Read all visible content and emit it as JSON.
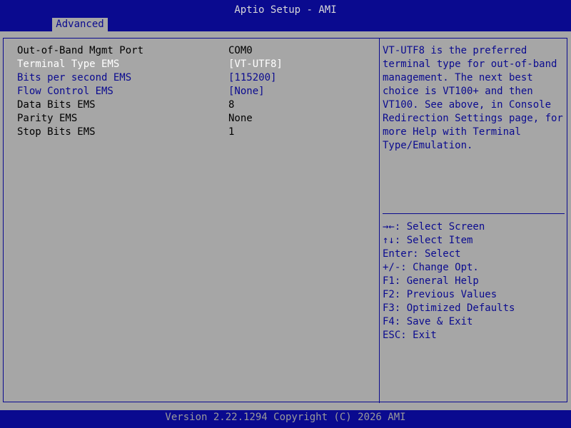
{
  "header": {
    "title": "Aptio Setup - AMI",
    "tabs": [
      {
        "label": "Advanced",
        "active": true
      }
    ]
  },
  "settings": [
    {
      "label": "Out-of-Band Mgmt Port",
      "value": "COM0",
      "state": "static"
    },
    {
      "label": "Terminal Type EMS",
      "value": "[VT-UTF8]",
      "state": "selected"
    },
    {
      "label": "Bits per second EMS",
      "value": "[115200]",
      "state": "selectable"
    },
    {
      "label": "Flow Control EMS",
      "value": "[None]",
      "state": "selectable"
    },
    {
      "label": "Data Bits EMS",
      "value": "8",
      "state": "static"
    },
    {
      "label": "Parity EMS",
      "value": "None",
      "state": "static"
    },
    {
      "label": "Stop Bits EMS",
      "value": "1",
      "state": "static"
    }
  ],
  "help": {
    "lines": [
      "VT-UTF8 is the preferred",
      "terminal type for out-of-band",
      "management. The next best",
      "choice is VT100+ and then",
      "VT100. See above, in Console",
      "Redirection Settings page, for",
      "more Help with Terminal",
      "Type/Emulation."
    ]
  },
  "keys": [
    "→←: Select Screen",
    "↑↓: Select Item",
    "Enter: Select",
    "+/-: Change Opt.",
    "F1: General Help",
    "F2: Previous Values",
    "F3: Optimized Defaults",
    "F4: Save & Exit",
    "ESC: Exit"
  ],
  "footer": {
    "text": "Version 2.22.1294 Copyright (C) 2026 AMI"
  },
  "colors": {
    "bar": "#0a0a8f",
    "panel": "#a6a6a6",
    "selected_text": "#ffffff",
    "selectable_text": "#0a0a8f"
  }
}
